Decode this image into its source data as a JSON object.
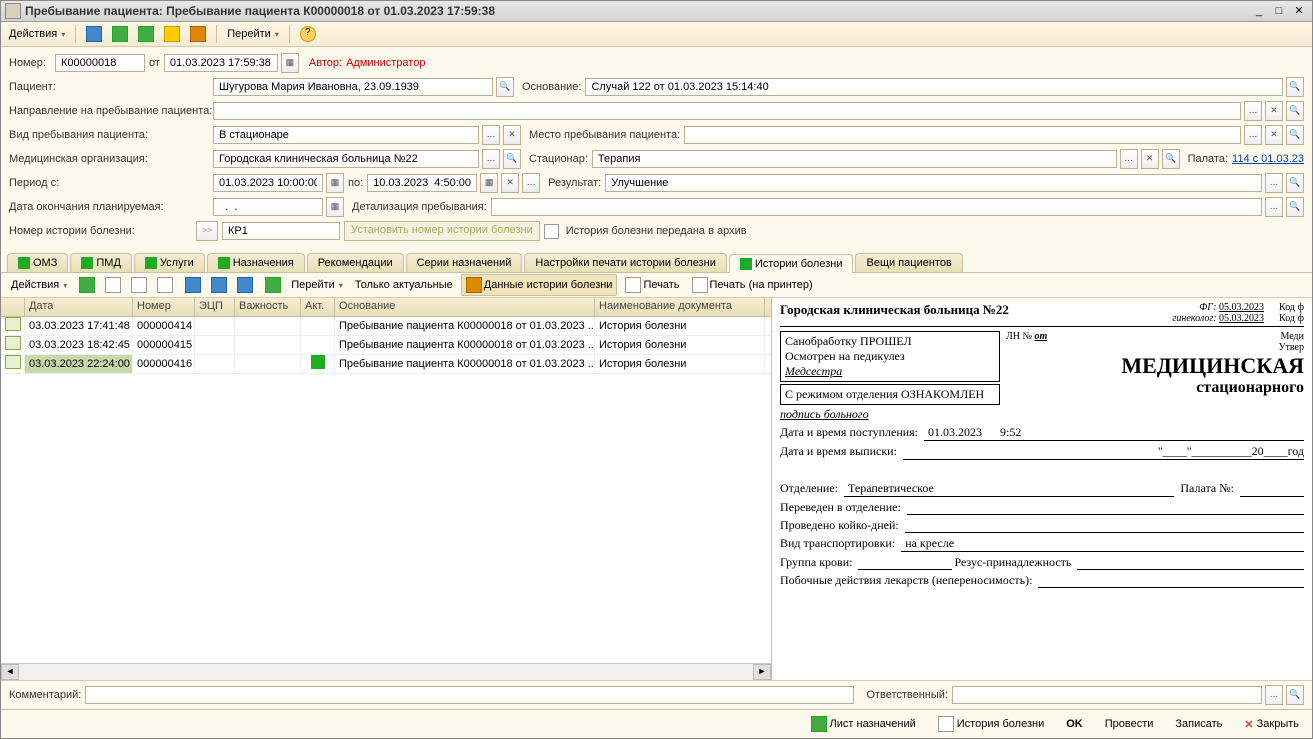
{
  "window": {
    "title": "Пребывание пациента: Пребывание пациента К00000018 от 01.03.2023 17:59:38"
  },
  "main_toolbar": {
    "actions": "Действия",
    "goto": "Перейти",
    "help": "?"
  },
  "header": {
    "number_label": "Номер:",
    "number": "К00000018",
    "from": "от",
    "datetime": "01.03.2023 17:59:38",
    "author_label": "Автор:",
    "author": "Администратор"
  },
  "fields": {
    "patient_label": "Пациент:",
    "patient": "Шугурова Мария Ивановна, 23.09.1939",
    "basis_label": "Основание:",
    "basis": "Случай 122 от 01.03.2023 15:14:40",
    "referral_label": "Направление на пребывание пациента:",
    "stay_type_label": "Вид пребывания пациента:",
    "stay_type": "В стационаре",
    "stay_place_label": "Место пребывания пациента:",
    "med_org_label": "Медицинская организация:",
    "med_org": "Городская клиническая больница №22",
    "department_label": "Стационар:",
    "department": "Терапия",
    "ward_label": "Палата:",
    "ward_link": "114 с 01.03.23",
    "period_from_label": "Период с:",
    "period_from": "01.03.2023 10:00:00",
    "period_to_label": "по:",
    "period_to": "10.03.2023  4:50:00",
    "result_label": "Результат:",
    "result": "Улучшение",
    "end_date_label": "Дата окончания планируемая:",
    "end_date": "  .  .    ",
    "detail_label": "Детализация пребывания:",
    "history_no_label": "Номер истории болезни:",
    "history_go": ">>",
    "history_no": "КР1",
    "set_history_btn": "Установить номер истории болезни",
    "archive_label": "История болезни передана в архив"
  },
  "tabs": [
    {
      "label": "ОМЗ",
      "chk": true
    },
    {
      "label": "ПМД",
      "chk": true
    },
    {
      "label": "Услуги",
      "chk": true
    },
    {
      "label": "Назначения",
      "chk": true
    },
    {
      "label": "Рекомендации",
      "chk": false
    },
    {
      "label": "Серии назначений",
      "chk": false
    },
    {
      "label": "Настройки печати истории болезни",
      "chk": false
    },
    {
      "label": "Истории болезни",
      "chk": true,
      "active": true
    },
    {
      "label": "Вещи пациентов",
      "chk": false
    }
  ],
  "sub_toolbar": {
    "actions": "Действия",
    "goto": "Перейти",
    "only_actual": "Только актуальные",
    "case_data": "Данные истории болезни",
    "print1": "Печать",
    "print2": "Печать (на принтер)"
  },
  "grid": {
    "columns": [
      "",
      "Дата",
      "Номер",
      "ЭЦП",
      "Важность",
      "Акт.",
      "Основание",
      "Наименование документа"
    ],
    "widths": [
      24,
      108,
      62,
      40,
      66,
      34,
      260,
      170
    ],
    "rows": [
      {
        "date": "03.03.2023 17:41:48",
        "num": "000000414",
        "act": false,
        "basis": "Пребывание пациента К00000018 от 01.03.2023 ...",
        "doc": "История болезни"
      },
      {
        "date": "03.03.2023 18:42:45",
        "num": "000000415",
        "act": false,
        "basis": "Пребывание пациента К00000018 от 01.03.2023 ...",
        "doc": "История болезни"
      },
      {
        "date": "03.03.2023 22:24:00",
        "num": "000000416",
        "act": true,
        "basis": "Пребывание пациента К00000018 от 01.03.2023 ...",
        "doc": "История болезни",
        "selected": true
      }
    ]
  },
  "preview": {
    "hospital": "Городская клиническая больница №22",
    "fg_label": "ФГ:",
    "fg_date": "05.03.2023",
    "gyn_label": "гинеколог:",
    "gyn_date": "05.03.2023",
    "code1": "Код ф",
    "code2": "Код ф",
    "san": "Санобработку ПРОШЕЛ",
    "ped": "Осмотрен на педикулез",
    "nurse": "Медсестра",
    "ln_label": "ЛН №",
    "ln_val": "от",
    "med": "Меди",
    "utv": "Утвер",
    "regime": "С режимом отделения ОЗНАКОМЛЕН",
    "sign": "подпись больного",
    "title_big": "МЕДИЦИНСКАЯ",
    "title_sub": "стационарного",
    "admit_label": "Дата и время поступления:",
    "admit_date": "01.03.2023",
    "admit_time": "9:52",
    "discharge_label": "Дата и время выписки:",
    "year_tail": "20____год",
    "dept_label": "Отделение:",
    "dept": "Терапевтическое",
    "ward2_label": "Палата №:",
    "transfer_label": "Переведен в отделение:",
    "beddays_label": "Проведено койко-дней:",
    "transport_label": "Вид транспортировки:",
    "transport": "на кресле",
    "blood_label": "Группа крови:",
    "rh_label": "Резус-принадлежность",
    "side_label": "Побочные действия лекарств (непереносимость):"
  },
  "footer": {
    "comment_label": "Комментарий:",
    "responsible_label": "Ответственный:"
  },
  "bottom": {
    "sheet": "Лист назначений",
    "history": "История болезни",
    "ok": "OK",
    "post": "Провести",
    "save": "Записать",
    "close": "Закрыть"
  }
}
